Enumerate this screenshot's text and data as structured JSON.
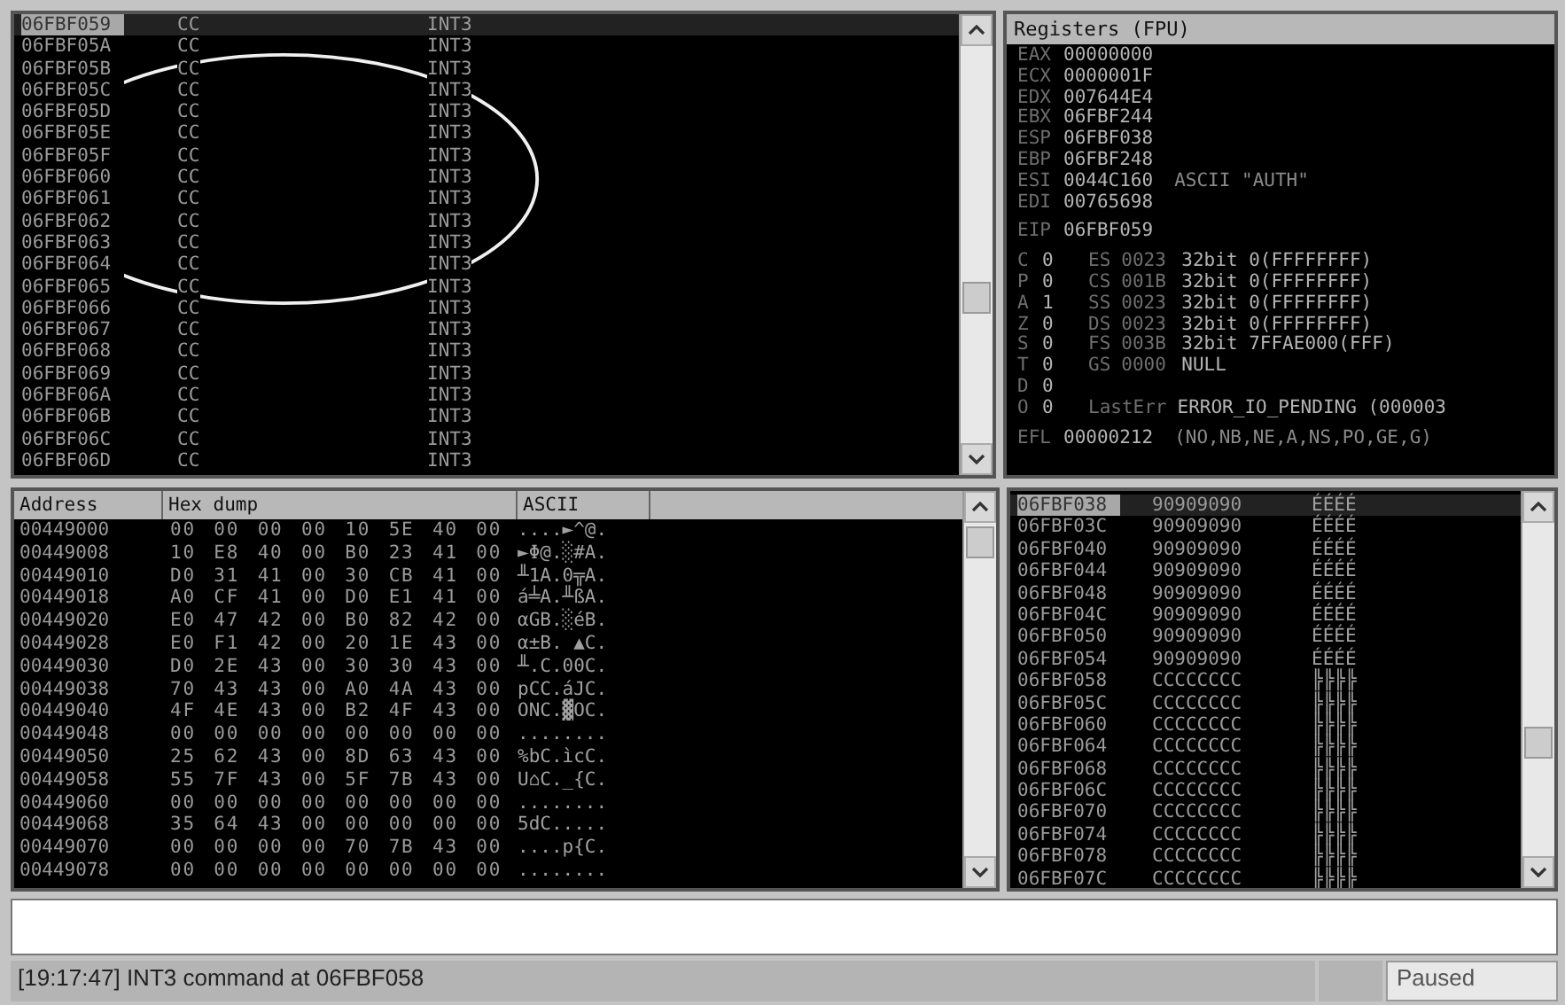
{
  "disassembly": {
    "rows": [
      {
        "address": "06FBF059",
        "hex": "CC",
        "command": "INT3",
        "selected": true
      },
      {
        "address": "06FBF05A",
        "hex": "CC",
        "command": "INT3",
        "selected": false
      },
      {
        "address": "06FBF05B",
        "hex": "CC",
        "command": "INT3",
        "selected": false
      },
      {
        "address": "06FBF05C",
        "hex": "CC",
        "command": "INT3",
        "selected": false
      },
      {
        "address": "06FBF05D",
        "hex": "CC",
        "command": "INT3",
        "selected": false
      },
      {
        "address": "06FBF05E",
        "hex": "CC",
        "command": "INT3",
        "selected": false
      },
      {
        "address": "06FBF05F",
        "hex": "CC",
        "command": "INT3",
        "selected": false
      },
      {
        "address": "06FBF060",
        "hex": "CC",
        "command": "INT3",
        "selected": false
      },
      {
        "address": "06FBF061",
        "hex": "CC",
        "command": "INT3",
        "selected": false
      },
      {
        "address": "06FBF062",
        "hex": "CC",
        "command": "INT3",
        "selected": false
      },
      {
        "address": "06FBF063",
        "hex": "CC",
        "command": "INT3",
        "selected": false
      },
      {
        "address": "06FBF064",
        "hex": "CC",
        "command": "INT3",
        "selected": false
      },
      {
        "address": "06FBF065",
        "hex": "CC",
        "command": "INT3",
        "selected": false
      },
      {
        "address": "06FBF066",
        "hex": "CC",
        "command": "INT3",
        "selected": false
      },
      {
        "address": "06FBF067",
        "hex": "CC",
        "command": "INT3",
        "selected": false
      },
      {
        "address": "06FBF068",
        "hex": "CC",
        "command": "INT3",
        "selected": false
      },
      {
        "address": "06FBF069",
        "hex": "CC",
        "command": "INT3",
        "selected": false
      },
      {
        "address": "06FBF06A",
        "hex": "CC",
        "command": "INT3",
        "selected": false
      },
      {
        "address": "06FBF06B",
        "hex": "CC",
        "command": "INT3",
        "selected": false
      },
      {
        "address": "06FBF06C",
        "hex": "CC",
        "command": "INT3",
        "selected": false
      },
      {
        "address": "06FBF06D",
        "hex": "CC",
        "command": "INT3",
        "selected": false
      }
    ]
  },
  "registers": {
    "title": "Registers (FPU)",
    "general": [
      {
        "name": "EAX",
        "value": "00000000"
      },
      {
        "name": "ECX",
        "value": "0000001F"
      },
      {
        "name": "EDX",
        "value": "007644E4"
      },
      {
        "name": "EBX",
        "value": "06FBF244"
      },
      {
        "name": "ESP",
        "value": "06FBF038"
      },
      {
        "name": "EBP",
        "value": "06FBF248"
      },
      {
        "name": "ESI",
        "value": "0044C160",
        "comment": "ASCII \"AUTH\""
      },
      {
        "name": "EDI",
        "value": "00765698"
      }
    ],
    "eip": {
      "name": "EIP",
      "value": "06FBF059"
    },
    "flags": [
      {
        "flag": "C",
        "bit": "0",
        "label": "ES",
        "value": "0023",
        "note": "32bit 0(FFFFFFFF)"
      },
      {
        "flag": "P",
        "bit": "0",
        "label": "CS",
        "value": "001B",
        "note": "32bit 0(FFFFFFFF)"
      },
      {
        "flag": "A",
        "bit": "1",
        "label": "SS",
        "value": "0023",
        "note": "32bit 0(FFFFFFFF)"
      },
      {
        "flag": "Z",
        "bit": "0",
        "label": "DS",
        "value": "0023",
        "note": "32bit 0(FFFFFFFF)"
      },
      {
        "flag": "S",
        "bit": "0",
        "label": "FS",
        "value": "003B",
        "note": "32bit 7FFAE000(FFF)"
      },
      {
        "flag": "T",
        "bit": "0",
        "label": "GS",
        "value": "0000",
        "note": "NULL"
      },
      {
        "flag": "D",
        "bit": "0"
      },
      {
        "flag": "O",
        "bit": "0",
        "label": "LastErr",
        "note": "ERROR_IO_PENDING (000003"
      }
    ],
    "efl": {
      "name": "EFL",
      "value": "00000212",
      "comment": "(NO,NB,NE,A,NS,PO,GE,G)"
    }
  },
  "dump": {
    "columns": [
      "Address",
      "Hex dump",
      "ASCII"
    ],
    "rows": [
      {
        "address": "00449000",
        "hex": "00 00 00 00 10 5E 40 00",
        "ascii": "....►^@."
      },
      {
        "address": "00449008",
        "hex": "10 E8 40 00 B0 23 41 00",
        "ascii": "►Φ@.░#A."
      },
      {
        "address": "00449010",
        "hex": "D0 31 41 00 30 CB 41 00",
        "ascii": "╨1A.0╦A."
      },
      {
        "address": "00449018",
        "hex": "A0 CF 41 00 D0 E1 41 00",
        "ascii": "á╧A.╨ßA."
      },
      {
        "address": "00449020",
        "hex": "E0 47 42 00 B0 82 42 00",
        "ascii": "αGB.░éB."
      },
      {
        "address": "00449028",
        "hex": "E0 F1 42 00 20 1E 43 00",
        "ascii": "α±B. ▲C."
      },
      {
        "address": "00449030",
        "hex": "D0 2E 43 00 30 30 43 00",
        "ascii": "╨.C.00C."
      },
      {
        "address": "00449038",
        "hex": "70 43 43 00 A0 4A 43 00",
        "ascii": "pCC.áJC."
      },
      {
        "address": "00449040",
        "hex": "4F 4E 43 00 B2 4F 43 00",
        "ascii": "ONC.▓OC."
      },
      {
        "address": "00449048",
        "hex": "00 00 00 00 00 00 00 00",
        "ascii": "........"
      },
      {
        "address": "00449050",
        "hex": "25 62 43 00 8D 63 43 00",
        "ascii": "%bC.ìcC."
      },
      {
        "address": "00449058",
        "hex": "55 7F 43 00 5F 7B 43 00",
        "ascii": "U⌂C._{C."
      },
      {
        "address": "00449060",
        "hex": "00 00 00 00 00 00 00 00",
        "ascii": "........"
      },
      {
        "address": "00449068",
        "hex": "35 64 43 00 00 00 00 00",
        "ascii": "5dC....."
      },
      {
        "address": "00449070",
        "hex": "00 00 00 00 70 7B 43 00",
        "ascii": "....p{C."
      },
      {
        "address": "00449078",
        "hex": "00 00 00 00 00 00 00 00",
        "ascii": "........"
      }
    ]
  },
  "stack": {
    "rows": [
      {
        "address": "06FBF038",
        "value": "90909090",
        "ascii": "ÉÉÉÉ",
        "selected": true
      },
      {
        "address": "06FBF03C",
        "value": "90909090",
        "ascii": "ÉÉÉÉ",
        "selected": false
      },
      {
        "address": "06FBF040",
        "value": "90909090",
        "ascii": "ÉÉÉÉ",
        "selected": false
      },
      {
        "address": "06FBF044",
        "value": "90909090",
        "ascii": "ÉÉÉÉ",
        "selected": false
      },
      {
        "address": "06FBF048",
        "value": "90909090",
        "ascii": "ÉÉÉÉ",
        "selected": false
      },
      {
        "address": "06FBF04C",
        "value": "90909090",
        "ascii": "ÉÉÉÉ",
        "selected": false
      },
      {
        "address": "06FBF050",
        "value": "90909090",
        "ascii": "ÉÉÉÉ",
        "selected": false
      },
      {
        "address": "06FBF054",
        "value": "90909090",
        "ascii": "ÉÉÉÉ",
        "selected": false
      },
      {
        "address": "06FBF058",
        "value": "CCCCCCCC",
        "ascii": "╠╠╠╠",
        "selected": false
      },
      {
        "address": "06FBF05C",
        "value": "CCCCCCCC",
        "ascii": "╠╠╠╠",
        "selected": false
      },
      {
        "address": "06FBF060",
        "value": "CCCCCCCC",
        "ascii": "╠╠╠╠",
        "selected": false
      },
      {
        "address": "06FBF064",
        "value": "CCCCCCCC",
        "ascii": "╠╠╠╠",
        "selected": false
      },
      {
        "address": "06FBF068",
        "value": "CCCCCCCC",
        "ascii": "╠╠╠╠",
        "selected": false
      },
      {
        "address": "06FBF06C",
        "value": "CCCCCCCC",
        "ascii": "╠╠╠╠",
        "selected": false
      },
      {
        "address": "06FBF070",
        "value": "CCCCCCCC",
        "ascii": "╠╠╠╠",
        "selected": false
      },
      {
        "address": "06FBF074",
        "value": "CCCCCCCC",
        "ascii": "╠╠╠╠",
        "selected": false
      },
      {
        "address": "06FBF078",
        "value": "CCCCCCCC",
        "ascii": "╠╠╠╠",
        "selected": false
      },
      {
        "address": "06FBF07C",
        "value": "CCCCCCCC",
        "ascii": "╠╠╠╠",
        "selected": false
      }
    ]
  },
  "status_bar": {
    "message": "[19:17:47] INT3 command at 06FBF058",
    "state": "Paused"
  }
}
